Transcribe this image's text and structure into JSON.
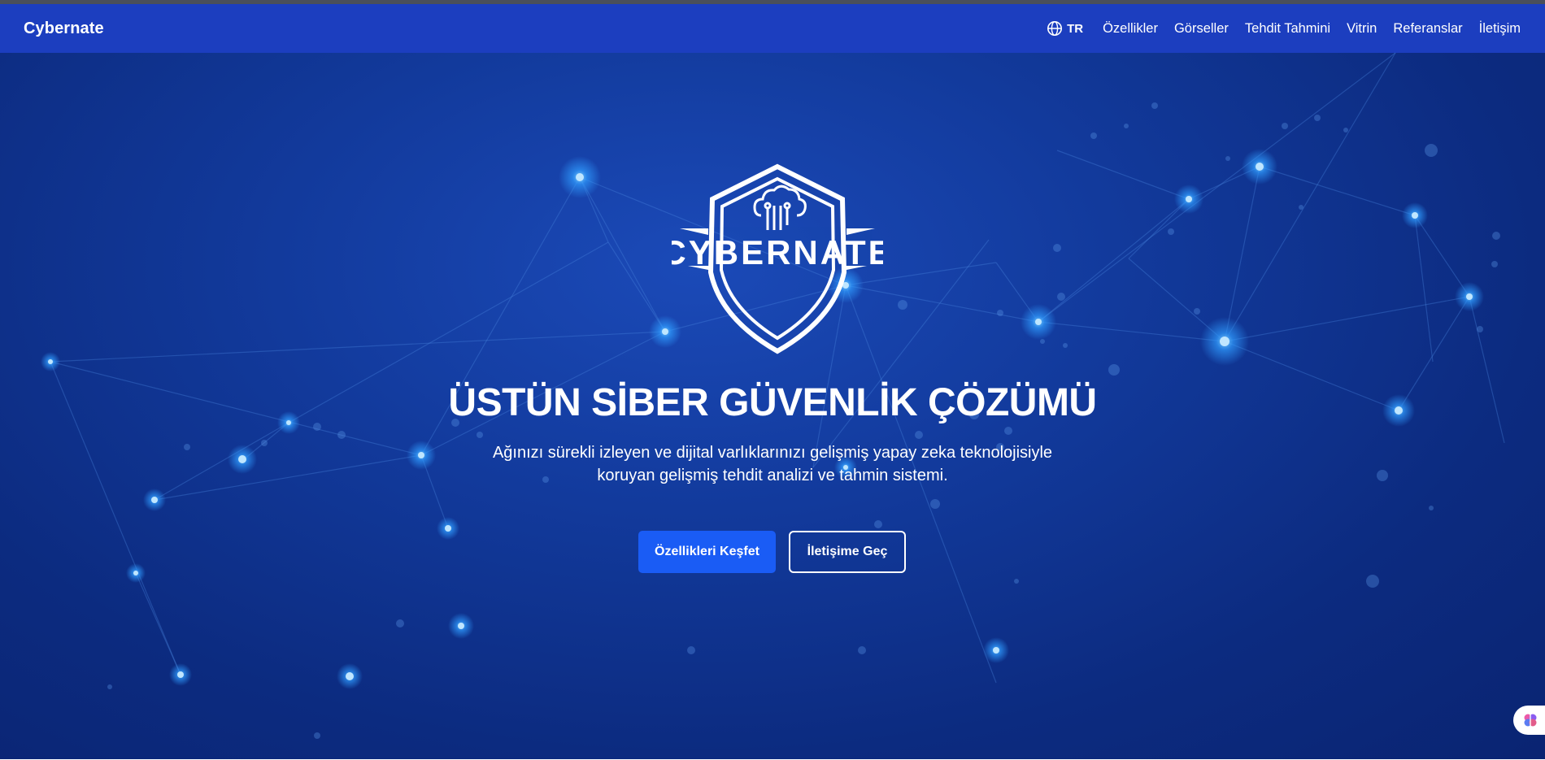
{
  "navbar": {
    "brand": "Cybernate",
    "language": {
      "icon": "globe-icon",
      "label": "TR"
    },
    "links": [
      "Özellikler",
      "Görseller",
      "Tehdit Tahmini",
      "Vitrin",
      "Referanslar",
      "İletişim"
    ]
  },
  "hero": {
    "logo_text": "CYBERNATE",
    "title": "ÜSTÜN SİBER GÜVENLİK ÇÖZÜMÜ",
    "description_line1": "Ağınızı sürekli izleyen ve dijital varlıklarınızı gelişmiş yapay zeka teknolojisiyle",
    "description_line2": "koruyan gelişmiş tehdit analizi ve tahmin sistemi.",
    "primary_button": "Özellikleri Keşfet",
    "secondary_button": "İletişime Geç"
  },
  "floating_button": {
    "icon": "brain-icon"
  },
  "colors": {
    "navbar": "#1c3ebf",
    "hero_background": "#123a9c",
    "primary_button": "#1a5cf5",
    "node_glow": "#3fa4ff"
  }
}
